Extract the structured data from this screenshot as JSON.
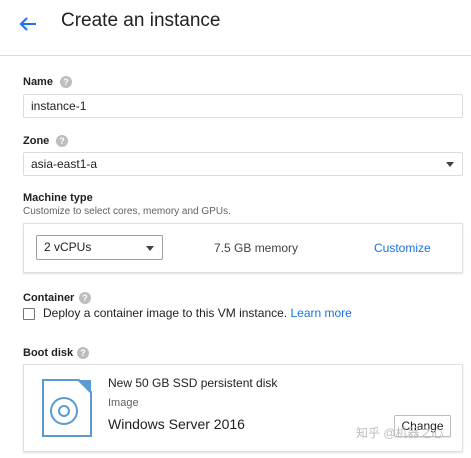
{
  "header": {
    "title": "Create an instance",
    "back_icon": "arrow-back-icon"
  },
  "name": {
    "label": "Name",
    "value": "instance-1"
  },
  "zone": {
    "label": "Zone",
    "value": "asia-east1-a"
  },
  "machine_type": {
    "label": "Machine type",
    "description": "Customize to select cores, memory and GPUs.",
    "cpu_value": "2 vCPUs",
    "memory": "7.5 GB memory",
    "customize_label": "Customize"
  },
  "container": {
    "label": "Container",
    "checkbox_text": "Deploy a container image to this VM instance.",
    "learn_more": "Learn more",
    "checked": false
  },
  "boot_disk": {
    "label": "Boot disk",
    "disk_desc": "New 50 GB SSD persistent disk",
    "image_label": "Image",
    "image_value": "Windows Server 2016",
    "change_label": "Change"
  },
  "watermark": "知乎 @机器之心",
  "colors": {
    "accent": "#1a73e8",
    "icon_blue": "#5b9bd5"
  }
}
